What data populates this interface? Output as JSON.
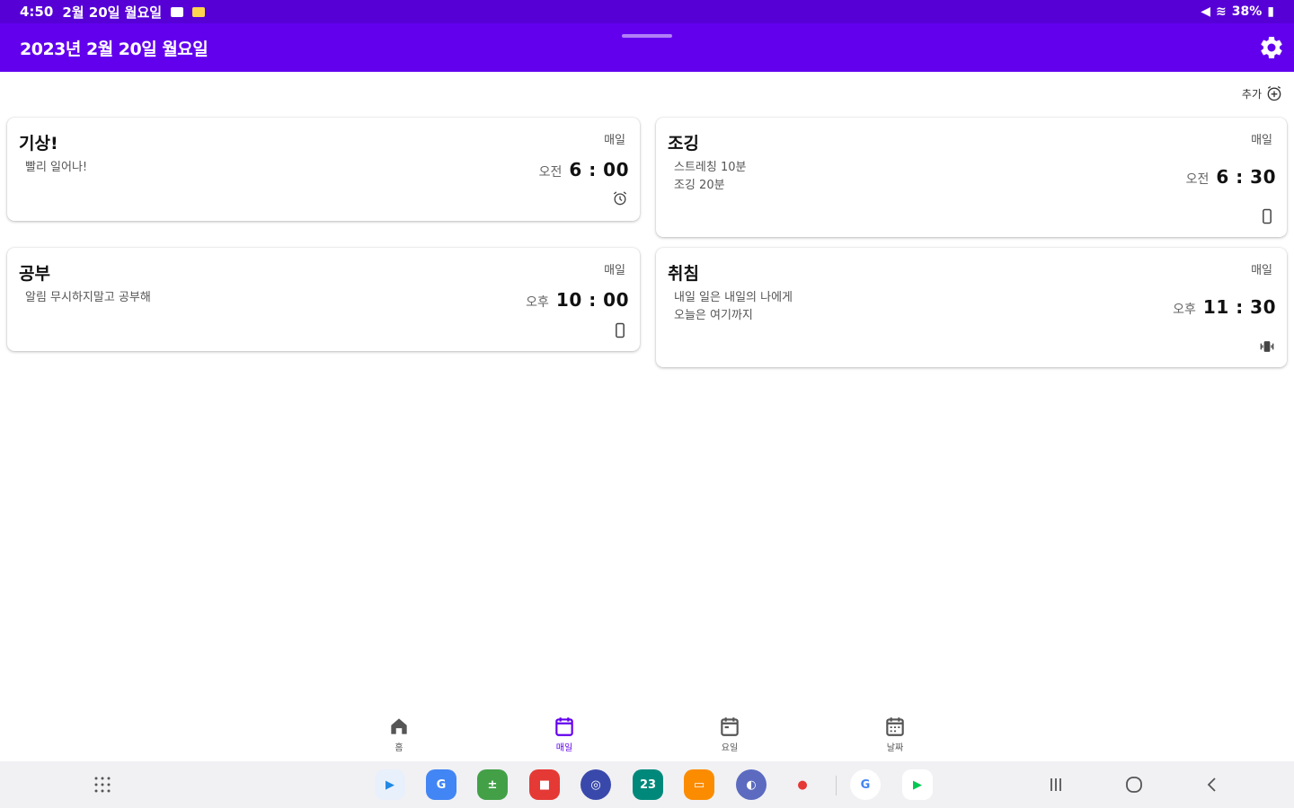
{
  "status_bar": {
    "time": "4:50",
    "date": "2월 20일 월요일",
    "battery": "38%"
  },
  "app_bar": {
    "title": "2023년 2월 20일 월요일",
    "settings_icon": "gear-icon"
  },
  "add": {
    "label": "추가",
    "icon": "add-alarm-icon"
  },
  "cards": [
    {
      "title": "기상!",
      "desc": "빨리 일어나!",
      "repeat": "매일",
      "ampm": "오전",
      "time": "6 : 00",
      "icon": "alarm-clock-icon"
    },
    {
      "title": "조깅",
      "desc": "스트레칭 10분\n조깅 20분",
      "repeat": "매일",
      "ampm": "오전",
      "time": "6 : 30",
      "icon": "phone-icon"
    },
    {
      "title": "공부",
      "desc": "알림 무시하지말고 공부해",
      "repeat": "매일",
      "ampm": "오후",
      "time": "10 : 00",
      "icon": "phone-icon"
    },
    {
      "title": "취침",
      "desc": "내일 일은 내일의 나에게\n오늘은 여기까지",
      "repeat": "매일",
      "ampm": "오후",
      "time": "11 : 30",
      "icon": "vibrate-icon"
    }
  ],
  "bottom_nav": [
    {
      "label": "홈",
      "icon": "home-icon",
      "active": false
    },
    {
      "label": "매일",
      "icon": "calendar-icon",
      "active": true
    },
    {
      "label": "요일",
      "icon": "calendar-week-icon",
      "active": false
    },
    {
      "label": "날짜",
      "icon": "calendar-date-icon",
      "active": false
    }
  ],
  "taskbar": {
    "apps": [
      {
        "name": "play-movies-icon",
        "color": "#1e88e5",
        "glyph": "▶"
      },
      {
        "name": "translate-icon",
        "color": "#4285f4",
        "glyph": "G"
      },
      {
        "name": "calculator-icon",
        "color": "#43a047",
        "glyph": "±"
      },
      {
        "name": "notes-icon",
        "color": "#e53935",
        "glyph": "■"
      },
      {
        "name": "compass-icon",
        "color": "#3949ab",
        "glyph": "◎"
      },
      {
        "name": "calendar-app-icon",
        "color": "#00897b",
        "glyph": "23"
      },
      {
        "name": "folder-icon",
        "color": "#fb8c00",
        "glyph": "▭"
      },
      {
        "name": "internet-icon",
        "color": "#5c6bc0",
        "glyph": "◐"
      },
      {
        "name": "bixby-icon",
        "color": "#e53935",
        "glyph": "●"
      },
      {
        "name": "google-icon",
        "color": "#ffffff",
        "glyph": "G"
      },
      {
        "name": "play-store-icon",
        "color": "#ffffff",
        "glyph": "▶"
      }
    ]
  }
}
